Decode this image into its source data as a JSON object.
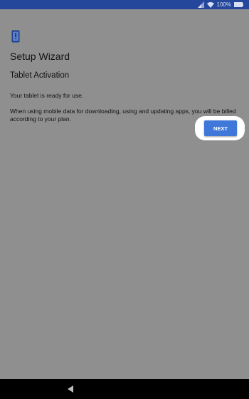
{
  "status_bar": {
    "battery_text": "100%",
    "signal_icon": "signal-icon",
    "wifi_icon": "wifi-icon",
    "battery_icon": "battery-icon"
  },
  "wizard": {
    "icon": "phone-alert-icon",
    "title": "Setup Wizard",
    "subtitle": "Tablet Activation",
    "ready_text": "Your tablet is ready for use.",
    "billing_text": "When using mobile data for downloading, using and updating apps, you will be billed according to your plan.",
    "next_label": "NEXT"
  },
  "nav_bar": {
    "back_icon": "back-icon"
  },
  "colors": {
    "status_bar": "#25479b",
    "overlay_background": "#8f8f8f",
    "next_button": "#3f78d8",
    "nav_bar": "#000000"
  }
}
